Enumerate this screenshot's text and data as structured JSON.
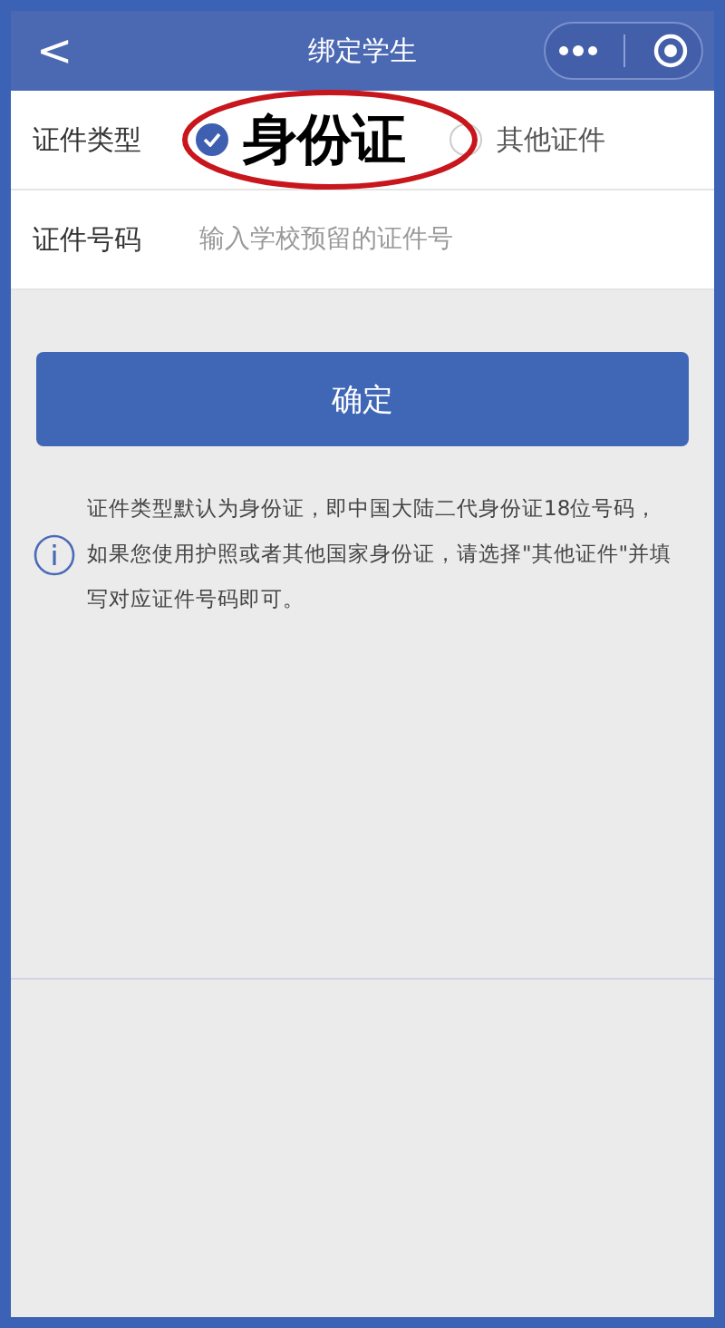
{
  "header": {
    "back": "<",
    "title": "绑定学生"
  },
  "id_type": {
    "label": "证件类型",
    "options": [
      {
        "label": "身份证",
        "selected": true,
        "highlighted": true
      },
      {
        "label": "其他证件",
        "selected": false,
        "highlighted": false
      }
    ]
  },
  "id_number": {
    "label": "证件号码",
    "placeholder": "输入学校预留的证件号"
  },
  "confirm_button": "确定",
  "info_text": "证件类型默认为身份证，即中国大陆二代身份证18位号码，如果您使用护照或者其他国家身份证，请选择\"其他证件\"并填写对应证件号码即可。"
}
